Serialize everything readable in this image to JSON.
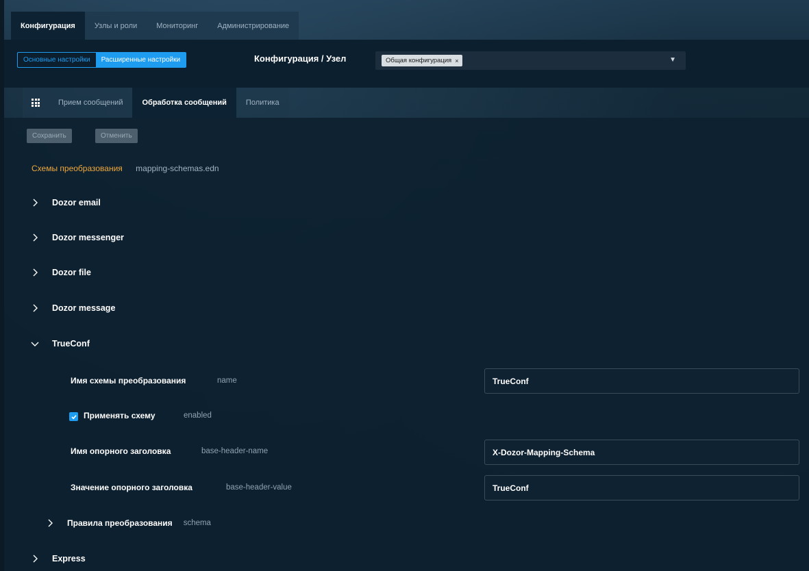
{
  "top_tabs": [
    {
      "label": "Конфигурация",
      "active": true
    },
    {
      "label": "Узлы и роли",
      "active": false
    },
    {
      "label": "Мониторинг",
      "active": false
    },
    {
      "label": "Администрирование",
      "active": false
    }
  ],
  "config": {
    "basic_label": "Основные настройки",
    "advanced_label": "Расширенные настройки",
    "selector_label": "Конфигурация / Узел",
    "selected_chip": "Общая конфигурация",
    "chip_remove": "×",
    "dropdown_arrow": "▼"
  },
  "sub_tabs": [
    {
      "label": "Прием сообщений"
    },
    {
      "label": "Обработка сообщений"
    },
    {
      "label": "Политика"
    }
  ],
  "actions": {
    "save": "Сохранить",
    "cancel": "Отменить"
  },
  "file": {
    "key": "Схемы преобразования",
    "value": "mapping-schemas.edn"
  },
  "schemas": [
    {
      "label": "Dozor email",
      "expanded": false
    },
    {
      "label": "Dozor messenger",
      "expanded": false
    },
    {
      "label": "Dozor file",
      "expanded": false
    },
    {
      "label": "Dozor message",
      "expanded": false
    },
    {
      "label": "TrueConf",
      "expanded": true
    },
    {
      "label": "Express",
      "expanded": false
    }
  ],
  "trueconf": {
    "name_label": "Имя схемы преобразования",
    "name_key": "name",
    "name_value": "TrueConf",
    "enabled_label": "Применять схему",
    "enabled_key": "enabled",
    "enabled_checked": true,
    "base_header_name_label": "Имя опорного заголовка",
    "base_header_name_key": "base-header-name",
    "base_header_name_value": "X-Dozor-Mapping-Schema",
    "base_header_value_label": "Значение опорного заголовка",
    "base_header_value_key": "base-header-value",
    "base_header_value_value": "TrueConf",
    "rules_label": "Правила преобразования",
    "rules_key": "schema"
  },
  "colors": {
    "accent": "#1e9cf0",
    "highlight": "#f0a83a",
    "background": "#0d1f2d"
  }
}
